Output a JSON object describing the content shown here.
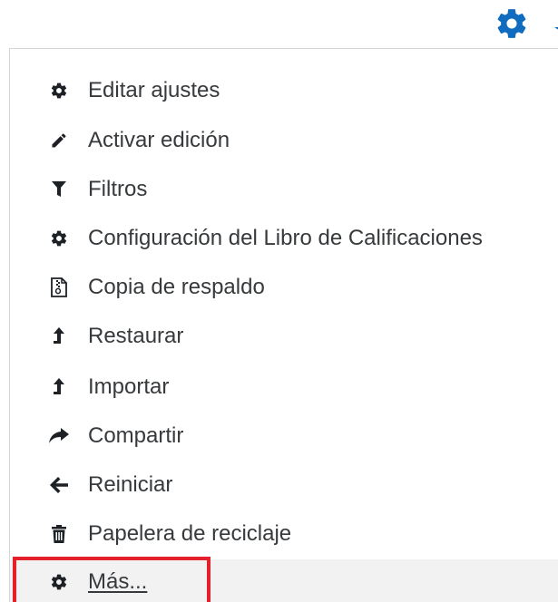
{
  "trigger": {
    "icon": "gear-icon",
    "caret_icon": "caret-down-icon",
    "color": "#0f6cbf"
  },
  "menu": {
    "items": [
      {
        "label": "Editar ajustes",
        "icon": "gear-icon"
      },
      {
        "label": "Activar edición",
        "icon": "pencil-icon"
      },
      {
        "label": "Filtros",
        "icon": "filter-icon"
      },
      {
        "label": "Configuración del Libro de Calificaciones",
        "icon": "gear-icon"
      },
      {
        "label": "Copia de respaldo",
        "icon": "file-archive-icon"
      },
      {
        "label": "Restaurar",
        "icon": "level-up-icon"
      },
      {
        "label": "Importar",
        "icon": "level-up-icon"
      },
      {
        "label": "Compartir",
        "icon": "share-icon"
      },
      {
        "label": "Reiniciar",
        "icon": "arrow-left-icon"
      },
      {
        "label": "Papelera de reciclaje",
        "icon": "trash-icon"
      },
      {
        "label": "Más...",
        "icon": "gear-icon"
      }
    ]
  },
  "colors": {
    "text": "#373a3c",
    "icon": "#1d2125",
    "highlight_border": "#e3202c",
    "more_background": "#f2f2f2"
  }
}
